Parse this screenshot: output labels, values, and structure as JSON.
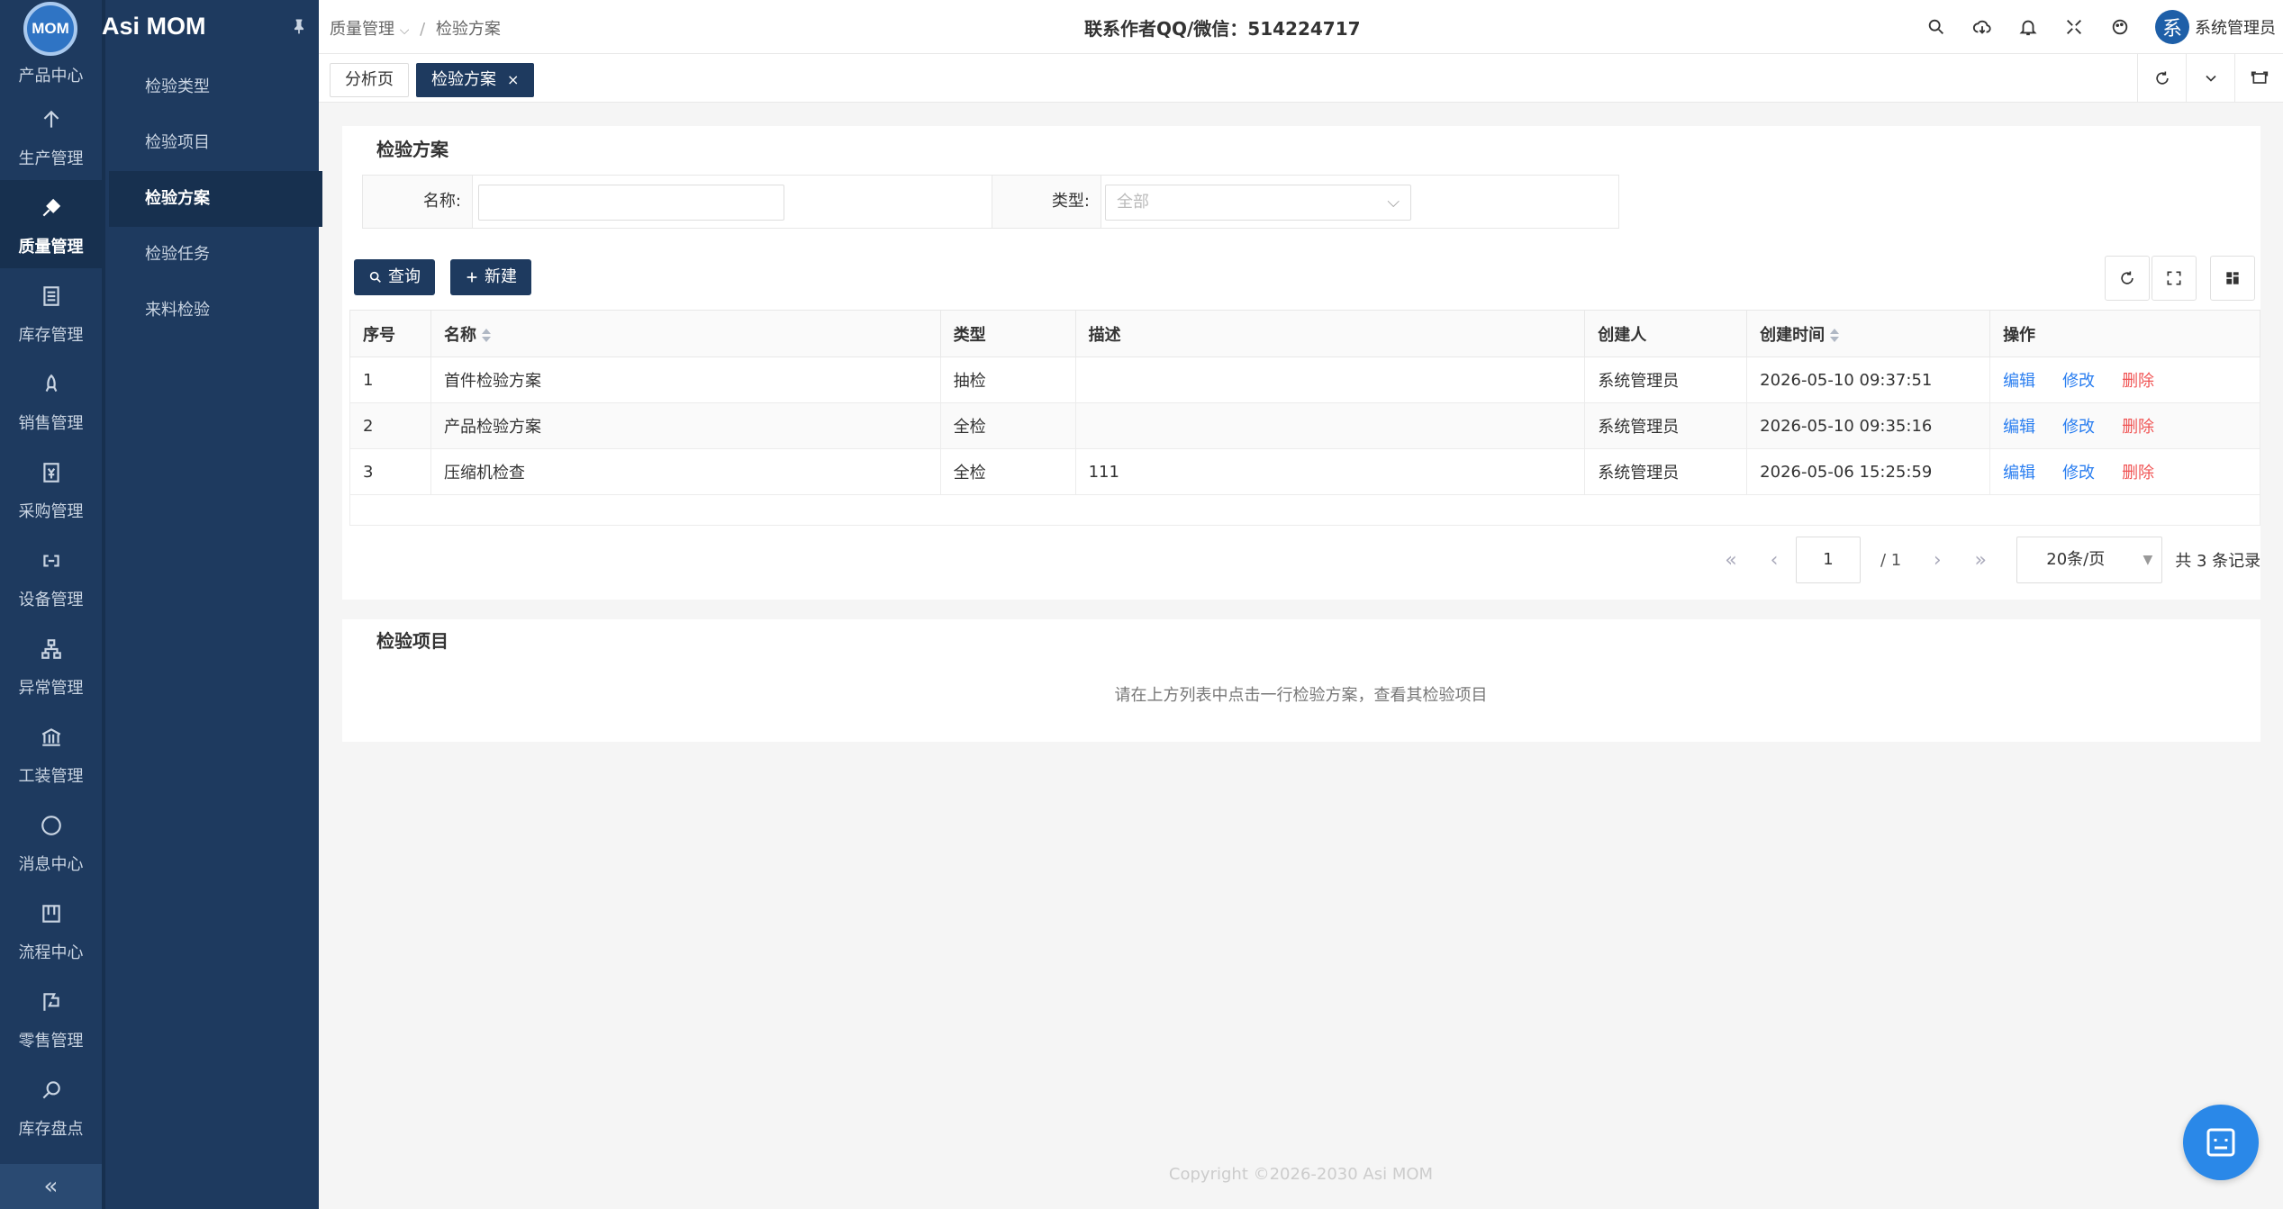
{
  "app": {
    "name": "Asi MOM",
    "logo_text": "MOM"
  },
  "rail": [
    {
      "label": "产品中心",
      "icon": "product-icon"
    },
    {
      "label": "生产管理",
      "icon": "arrow-up-icon"
    },
    {
      "label": "质量管理",
      "icon": "quality-icon",
      "active": true
    },
    {
      "label": "库存管理",
      "icon": "inventory-icon"
    },
    {
      "label": "销售管理",
      "icon": "rocket-icon"
    },
    {
      "label": "采购管理",
      "icon": "currency-icon"
    },
    {
      "label": "设备管理",
      "icon": "link-icon"
    },
    {
      "label": "异常管理",
      "icon": "org-icon"
    },
    {
      "label": "工装管理",
      "icon": "bank-icon"
    },
    {
      "label": "消息中心",
      "icon": "message-icon"
    },
    {
      "label": "流程中心",
      "icon": "board-icon"
    },
    {
      "label": "零售管理",
      "icon": "flag-icon"
    },
    {
      "label": "库存盘点",
      "icon": "search-icon"
    }
  ],
  "rail_collapse": "«",
  "submenu": [
    {
      "label": "检验类型"
    },
    {
      "label": "检验项目"
    },
    {
      "label": "检验方案",
      "active": true
    },
    {
      "label": "检验任务"
    },
    {
      "label": "来料检验"
    }
  ],
  "header": {
    "breadcrumb_1": "质量管理",
    "breadcrumb_sep": "/",
    "breadcrumb_2": "检验方案",
    "contact": "联系作者QQ/微信：514224717",
    "user_avatar": "系",
    "user_name": "系统管理员"
  },
  "tabs": [
    {
      "label": "分析页"
    },
    {
      "label": "检验方案",
      "active": true,
      "close": "×"
    }
  ],
  "plan_card": {
    "title": "检验方案",
    "name_label": "名称:",
    "name_value": "",
    "type_label": "类型:",
    "type_placeholder": "全部",
    "query_button": "查询",
    "new_button": "新建"
  },
  "table": {
    "columns": [
      "序号",
      "名称",
      "类型",
      "描述",
      "创建人",
      "创建时间",
      "操作"
    ],
    "rows": [
      {
        "no": "1",
        "name": "首件检验方案",
        "type": "抽检",
        "desc": "",
        "creator": "系统管理员",
        "time": "2026-05-10 09:37:51"
      },
      {
        "no": "2",
        "name": "产品检验方案",
        "type": "全检",
        "desc": "",
        "creator": "系统管理员",
        "time": "2026-05-10 09:35:16"
      },
      {
        "no": "3",
        "name": "压缩机检查",
        "type": "全检",
        "desc": "111",
        "creator": "系统管理员",
        "time": "2026-05-06 15:25:59"
      }
    ],
    "actions": {
      "edit": "编辑",
      "modify": "修改",
      "delete": "删除"
    }
  },
  "pager": {
    "page": "1",
    "total_pages": "/ 1",
    "page_size": "20条/页",
    "total": "共 3 条记录"
  },
  "items_card": {
    "title": "检验项目",
    "hint": "请在上方列表中点击一行检验方案，查看其检验项目"
  },
  "footer": "Copyright ©2026-2030 Asi MOM",
  "colors": {
    "sidebar": "#1e3a5f",
    "accent": "#1e3a5f",
    "link": "#2a7ef0",
    "danger": "#f05454"
  }
}
